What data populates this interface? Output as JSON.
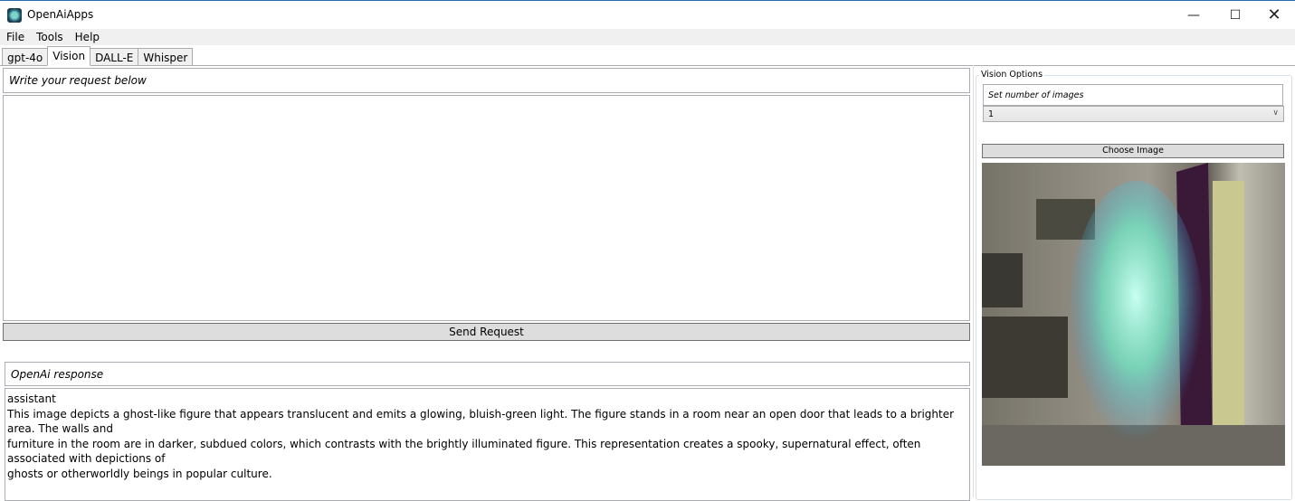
{
  "window": {
    "title": "OpenAiApps",
    "minimize_icon": "minimize-icon",
    "maximize_icon": "maximize-icon",
    "close_icon": "close-icon"
  },
  "menu": [
    "File",
    "Tools",
    "Help"
  ],
  "tabs": [
    {
      "label": "gpt-4o"
    },
    {
      "label": "Vision",
      "active": true
    },
    {
      "label": "DALL-E"
    },
    {
      "label": "Whisper"
    }
  ],
  "request": {
    "label": "Write your request below",
    "value": "",
    "send_label": "Send Request"
  },
  "response": {
    "label": "OpenAi response",
    "text": "assistant\nThis image depicts a ghost-like figure that appears translucent and emits a glowing, bluish-green light. The figure stands in a room near an open door that leads to a brighter area. The walls and\nfurniture in the room are in darker, subdued colors, which contrasts with the brightly illuminated figure. This representation creates a spooky, supernatural effect, often associated with depictions of\nghosts or otherworldly beings in popular culture."
  },
  "options": {
    "legend": "Vision Options",
    "set_label": "Set number of images",
    "count": "1",
    "choose_label": "Choose Image"
  }
}
